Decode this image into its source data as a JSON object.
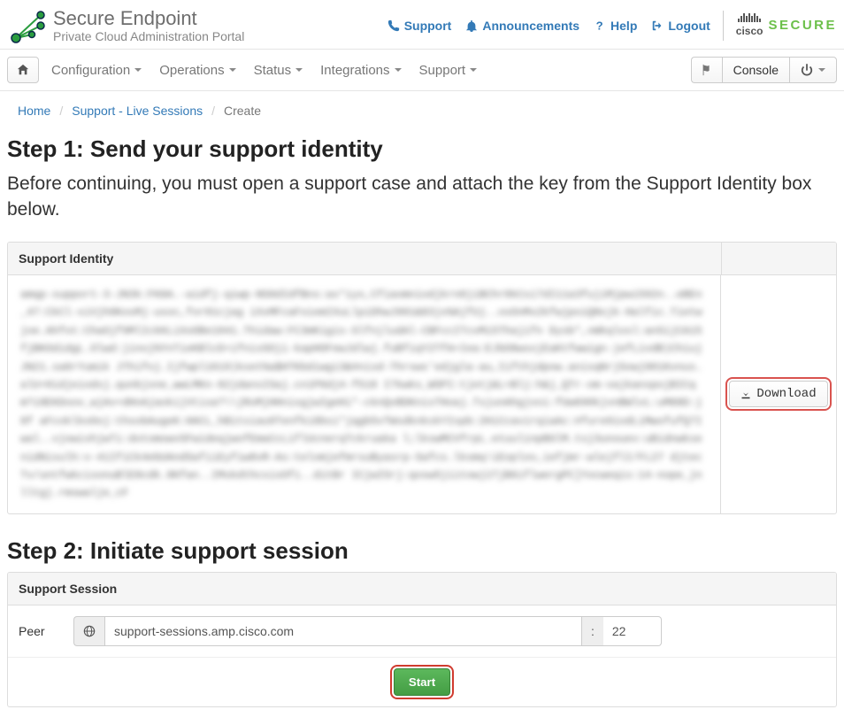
{
  "brand": {
    "title": "Secure Endpoint",
    "subtitle": "Private Cloud Administration Portal"
  },
  "header_links": {
    "support": "Support",
    "announcements": "Announcements",
    "help": "Help",
    "logout": "Logout"
  },
  "cisco": {
    "word": "cisco",
    "secure": "SECURE"
  },
  "nav": {
    "configuration": "Configuration",
    "operations": "Operations",
    "status": "Status",
    "integrations": "Integrations",
    "support": "Support",
    "console": "Console"
  },
  "breadcrumb": {
    "home": "Home",
    "support_sessions": "Support - Live Sessions",
    "create": "Create"
  },
  "step1": {
    "heading": "Step 1: Send your support identity",
    "lead": "Before continuing, you must open a support case and attach the key from the Support Identity box below.",
    "panel_title": "Support Identity",
    "download": "Download"
  },
  "step2": {
    "heading": "Step 2: Initiate support session",
    "panel_title": "Support Session",
    "peer_label": "Peer",
    "host_value": "support-sessions.amp.cisco.com",
    "colon": ":",
    "port_value": "22",
    "start": "Start"
  },
  "icons": {
    "phone": "phone",
    "bell": "bell",
    "help": "question",
    "logout": "sign-out",
    "home": "home",
    "flag": "flag",
    "power": "power",
    "download": "download",
    "globe": "globe"
  }
}
